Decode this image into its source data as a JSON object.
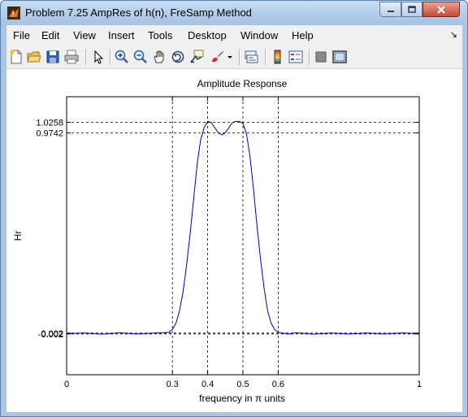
{
  "window": {
    "title": "Problem 7.25 AmpRes of h(n), FreSamp Method"
  },
  "menu": {
    "items": [
      "File",
      "Edit",
      "View",
      "Insert",
      "Tools",
      "Desktop",
      "Window",
      "Help"
    ],
    "arrow": "↘"
  },
  "toolbar": {
    "icons": [
      "new-figure-icon",
      "open-file-icon",
      "save-icon",
      "print-icon",
      "pointer-icon",
      "zoom-in-icon",
      "zoom-out-icon",
      "pan-hand-icon",
      "rotate-3d-icon",
      "data-cursor-icon",
      "brush-icon",
      "link-plot-icon",
      "colorbar-icon",
      "legend-icon",
      "hide-plot-tools-icon",
      "show-plot-tools-icon"
    ]
  },
  "chart_data": {
    "type": "line",
    "title": "Amplitude Response",
    "xlabel": "frequency in π units",
    "ylabel": "Hr",
    "xlim": [
      0,
      1
    ],
    "ylim": [
      -0.2,
      1.15
    ],
    "xticks": [
      0,
      0.3,
      0.4,
      0.5,
      0.6,
      1
    ],
    "xtick_labels": [
      "0",
      "0.3",
      "0.4",
      "0.5",
      "0.6",
      "1"
    ],
    "yticks": [
      -0.002,
      0.002,
      0.9742,
      1.0258
    ],
    "ytick_labels": [
      "-0.002",
      "0.002",
      "0.9742",
      "1.0258"
    ],
    "grid": "dashed at ticks",
    "series": [
      {
        "color": "#0000b4",
        "x": [
          0,
          0.05,
          0.1,
          0.15,
          0.2,
          0.25,
          0.27,
          0.29,
          0.3,
          0.31,
          0.32,
          0.33,
          0.34,
          0.35,
          0.36,
          0.37,
          0.38,
          0.39,
          0.4,
          0.41,
          0.42,
          0.43,
          0.44,
          0.45,
          0.46,
          0.47,
          0.48,
          0.49,
          0.5,
          0.51,
          0.52,
          0.53,
          0.54,
          0.55,
          0.56,
          0.57,
          0.58,
          0.59,
          0.6,
          0.61,
          0.63,
          0.65,
          0.7,
          0.75,
          0.8,
          0.85,
          0.9,
          0.95,
          1
        ],
        "y": [
          0,
          0.003,
          -0.003,
          0.004,
          -0.002,
          0.003,
          0.004,
          0.006,
          0.02,
          0.05,
          0.11,
          0.2,
          0.33,
          0.48,
          0.65,
          0.82,
          0.94,
          1.0,
          1.03,
          1.025,
          1.0,
          0.975,
          0.965,
          0.975,
          1.0,
          1.025,
          1.03,
          1.03,
          1.02,
          0.97,
          0.86,
          0.7,
          0.52,
          0.36,
          0.22,
          0.11,
          0.05,
          0.02,
          0.006,
          0.003,
          -0.002,
          0.004,
          -0.003,
          0.003,
          -0.002,
          0.003,
          -0.002,
          0.003,
          0
        ]
      }
    ]
  }
}
